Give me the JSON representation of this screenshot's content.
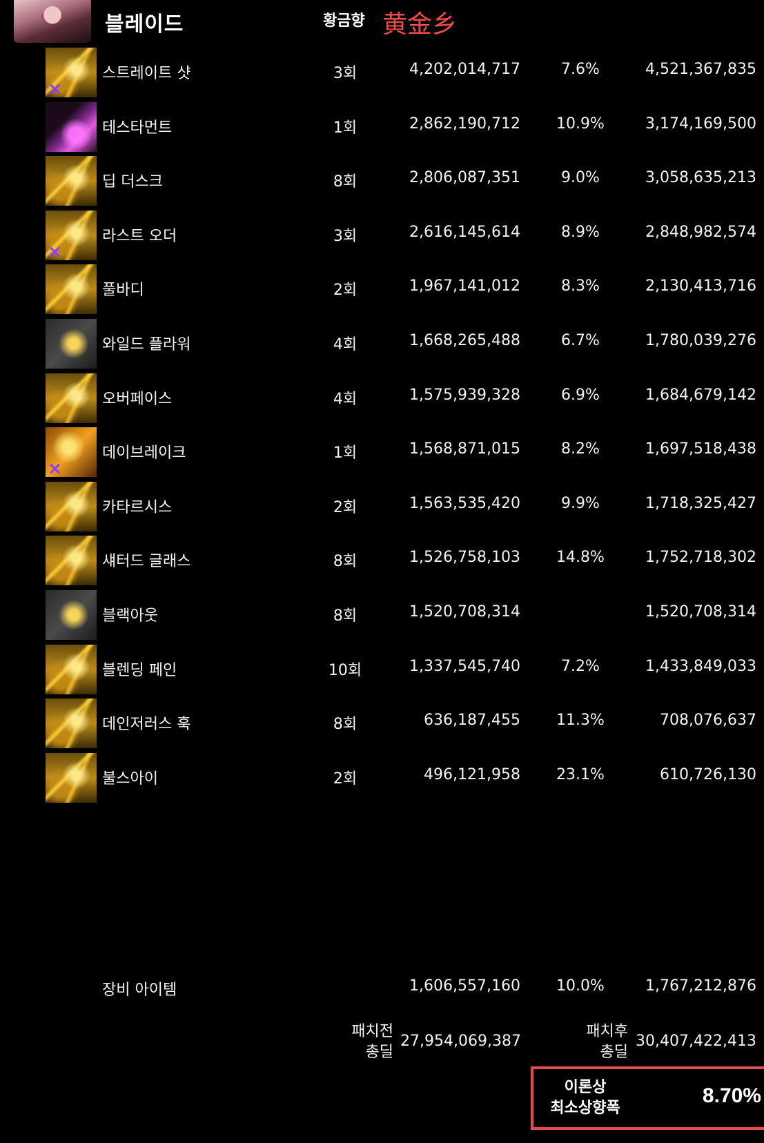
{
  "header": {
    "title": "블레이드",
    "label": "황금향",
    "label_red": "黄金乡"
  },
  "skills": [
    {
      "name": "스트레이트 샷",
      "count": "3회",
      "before": "4,202,014,717",
      "pct": "7.6%",
      "after": "4,521,367,835",
      "icon": "straight-shot-icon"
    },
    {
      "name": "테스타먼트",
      "count": "1회",
      "before": "2,862,190,712",
      "pct": "10.9%",
      "after": "3,174,169,500",
      "icon": "testament-icon"
    },
    {
      "name": "딥 더스크",
      "count": "8회",
      "before": "2,806,087,351",
      "pct": "9.0%",
      "after": "3,058,635,213",
      "icon": "deep-dusk-icon"
    },
    {
      "name": "라스트 오더",
      "count": "3회",
      "before": "2,616,145,614",
      "pct": "8.9%",
      "after": "2,848,982,574",
      "icon": "last-order-icon"
    },
    {
      "name": "풀바디",
      "count": "2회",
      "before": "1,967,141,012",
      "pct": "8.3%",
      "after": "2,130,413,716",
      "icon": "full-body-icon"
    },
    {
      "name": "와일드 플라워",
      "count": "4회",
      "before": "1,668,265,488",
      "pct": "6.7%",
      "after": "1,780,039,276",
      "icon": "wild-flower-icon"
    },
    {
      "name": "오버페이스",
      "count": "4회",
      "before": "1,575,939,328",
      "pct": "6.9%",
      "after": "1,684,679,142",
      "icon": "overpace-icon"
    },
    {
      "name": "데이브레이크",
      "count": "1회",
      "before": "1,568,871,015",
      "pct": "8.2%",
      "after": "1,697,518,438",
      "icon": "daybreak-icon"
    },
    {
      "name": "카타르시스",
      "count": "2회",
      "before": "1,563,535,420",
      "pct": "9.9%",
      "after": "1,718,325,427",
      "icon": "catharsis-icon"
    },
    {
      "name": "섀터드 글래스",
      "count": "8회",
      "before": "1,526,758,103",
      "pct": "14.8%",
      "after": "1,752,718,302",
      "icon": "shattered-glass-icon"
    },
    {
      "name": "블랙아웃",
      "count": "8회",
      "before": "1,520,708,314",
      "pct": "",
      "after": "1,520,708,314",
      "icon": "blackout-icon"
    },
    {
      "name": "블렌딩 페인",
      "count": "10회",
      "before": "1,337,545,740",
      "pct": "7.2%",
      "after": "1,433,849,033",
      "icon": "blending-pain-icon"
    },
    {
      "name": "데인저러스 훅",
      "count": "8회",
      "before": "636,187,455",
      "pct": "11.3%",
      "after": "708,076,637",
      "icon": "dangerous-hook-icon"
    },
    {
      "name": "불스아이",
      "count": "2회",
      "before": "496,121,958",
      "pct": "23.1%",
      "after": "610,726,130",
      "icon": "bullseye-icon"
    }
  ],
  "equipment": {
    "name": "장비 아이템",
    "before": "1,606,557,160",
    "pct": "10.0%",
    "after": "1,767,212,876"
  },
  "totals": {
    "before_label_1": "패치전",
    "before_label_2": "총딜",
    "before_value": "27,954,069,387",
    "after_label_1": "패치후",
    "after_label_2": "총딜",
    "after_value": "30,407,422,413"
  },
  "highlight": {
    "label_1": "이론상",
    "label_2": "최소상향폭",
    "value": "8.70%"
  },
  "colors": {
    "background": "#000000",
    "text": "#f3f3f3",
    "red_label": "#f04b4b",
    "highlight_border": "#e5484d",
    "icon_gold": "#d9a521"
  }
}
